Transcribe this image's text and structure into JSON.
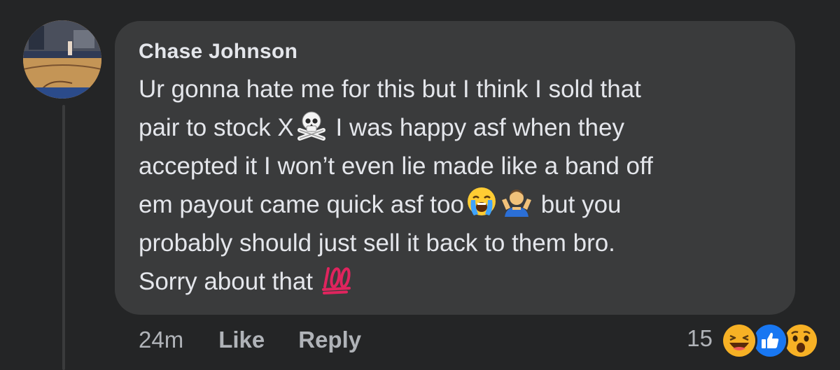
{
  "comment": {
    "author": "Chase Johnson",
    "lines": [
      {
        "before": "Ur gonna hate me for this but I think I sold that",
        "after": ""
      },
      {
        "before": "pair to stock X",
        "after": " I was happy asf when they"
      },
      {
        "before": "accepted it I won’t even lie made like a band off",
        "after": ""
      },
      {
        "before": "em payout came quick asf too",
        "after": " but you"
      },
      {
        "before": "probably should just sell it back to them bro.",
        "after": ""
      },
      {
        "before": "Sorry about that ",
        "after": ""
      }
    ],
    "emojis": [
      "skull-and-crossbones-icon",
      "loudly-crying-face-icon",
      "person-shrugging-icon",
      "hundred-points-icon"
    ]
  },
  "actions": {
    "timestamp": "24m",
    "like_label": "Like",
    "reply_label": "Reply"
  },
  "reactions": {
    "count": "15",
    "icons": [
      "haha-reaction-icon",
      "like-reaction-icon",
      "wow-reaction-icon"
    ],
    "like_color": "#1877f2",
    "haha_color": "#f7b125"
  },
  "colors": {
    "background": "#242526",
    "bubble": "#3a3b3c",
    "text": "#e4e6eb",
    "secondary_text": "#b0b3b8"
  }
}
